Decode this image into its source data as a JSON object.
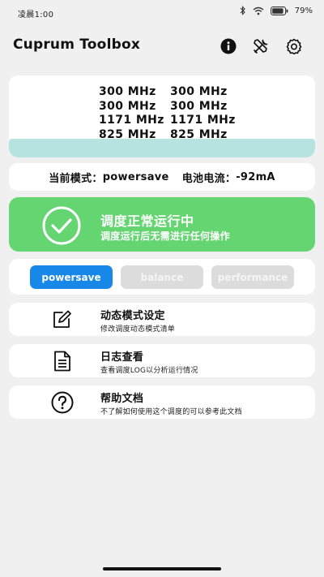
{
  "status_bar": {
    "time": "凌晨1:00",
    "battery": "79%"
  },
  "app": {
    "title": "Cuprum Toolbox"
  },
  "icons": {
    "info": "info-icon",
    "tools": "tools-icon",
    "settings": "gear-icon"
  },
  "frequencies": [
    [
      "300 MHz",
      "300 MHz"
    ],
    [
      "300 MHz",
      "300 MHz"
    ],
    [
      "1171 MHz",
      "1171 MHz"
    ],
    [
      "825 MHz",
      "825 MHz"
    ]
  ],
  "mode_info": {
    "current_mode_label": "当前模式：",
    "current_mode": "powersave",
    "battery_current_label": "电池电流：",
    "battery_current": "-92mA"
  },
  "scheduler_status": {
    "title": "调度正常运行中",
    "subtitle": "调度运行后无需进行任何操作",
    "color": "#64d571"
  },
  "mode_buttons": [
    {
      "label": "powersave",
      "active": true
    },
    {
      "label": "balance",
      "active": false
    },
    {
      "label": "performance",
      "active": false
    }
  ],
  "menu": [
    {
      "title": "动态模式设定",
      "subtitle": "修改调度动态模式清单",
      "icon": "edit-icon"
    },
    {
      "title": "日志查看",
      "subtitle": "查看调度LOG以分析运行情况",
      "icon": "document-icon"
    },
    {
      "title": "帮助文档",
      "subtitle": "不了解如何使用这个调度的可以参考此文档",
      "icon": "help-icon"
    }
  ],
  "colors": {
    "accent": "#1787e8",
    "success": "#64d571",
    "freq_bar": "#b6e3df"
  }
}
